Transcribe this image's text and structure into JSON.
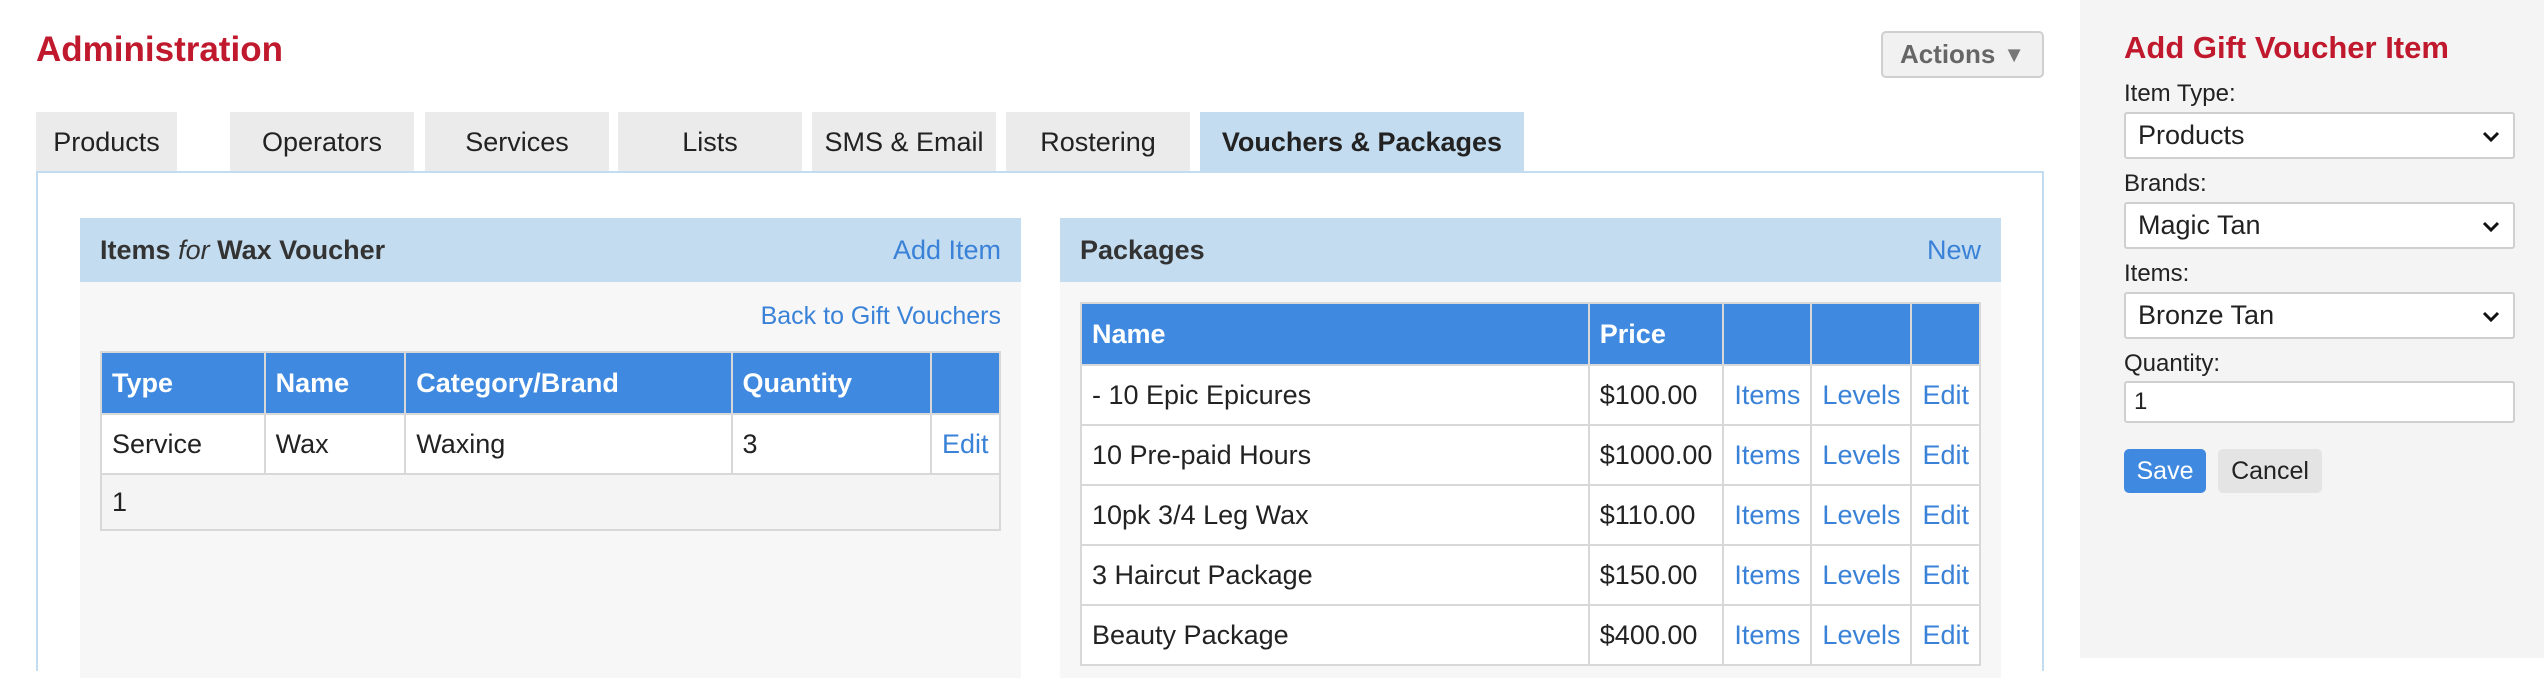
{
  "header": {
    "title": "Administration",
    "actions_label": "Actions"
  },
  "tabs": [
    {
      "label": "Products"
    },
    {
      "label": "Operators"
    },
    {
      "label": "Services"
    },
    {
      "label": "Lists"
    },
    {
      "label": "SMS & Email"
    },
    {
      "label": "Rostering"
    },
    {
      "label": "Vouchers & Packages",
      "active": true
    }
  ],
  "items_panel": {
    "title_prefix": "Items",
    "title_connector": "for",
    "title_subject": "Wax Voucher",
    "add_label": "Add Item",
    "back_label": "Back to Gift Vouchers",
    "columns": [
      "Type",
      "Name",
      "Category/Brand",
      "Quantity",
      ""
    ],
    "rows": [
      {
        "type": "Service",
        "name": "Wax",
        "category": "Waxing",
        "quantity": "3",
        "edit": "Edit"
      }
    ],
    "footer": "1"
  },
  "packages_panel": {
    "title": "Packages",
    "new_label": "New",
    "columns": [
      "Name",
      "Price",
      "",
      "",
      ""
    ],
    "rows": [
      {
        "name": "- 10 Epic Epicures",
        "price": "$100.00",
        "items": "Items",
        "levels": "Levels",
        "edit": "Edit"
      },
      {
        "name": "10 Pre-paid Hours",
        "price": "$1000.00",
        "items": "Items",
        "levels": "Levels",
        "edit": "Edit"
      },
      {
        "name": "10pk 3/4 Leg Wax",
        "price": "$110.00",
        "items": "Items",
        "levels": "Levels",
        "edit": "Edit"
      },
      {
        "name": "3 Haircut Package",
        "price": "$150.00",
        "items": "Items",
        "levels": "Levels",
        "edit": "Edit"
      },
      {
        "name": "Beauty Package",
        "price": "$400.00",
        "items": "Items",
        "levels": "Levels",
        "edit": "Edit"
      }
    ]
  },
  "sidebar": {
    "title": "Add Gift Voucher Item",
    "item_type_label": "Item Type:",
    "item_type_value": "Products",
    "brands_label": "Brands:",
    "brands_value": "Magic Tan",
    "items_label": "Items:",
    "items_value": "Bronze Tan",
    "quantity_label": "Quantity:",
    "quantity_value": "1",
    "save_label": "Save",
    "cancel_label": "Cancel"
  },
  "colors": {
    "brand_red": "#c0182c",
    "header_blue": "#3f8ae0",
    "panel_blue": "#c4dcef",
    "link_blue": "#3a82d8"
  },
  "icons": {
    "actions_arrow": "triangle-down-icon",
    "select_chevron": "chevron-down-icon"
  }
}
